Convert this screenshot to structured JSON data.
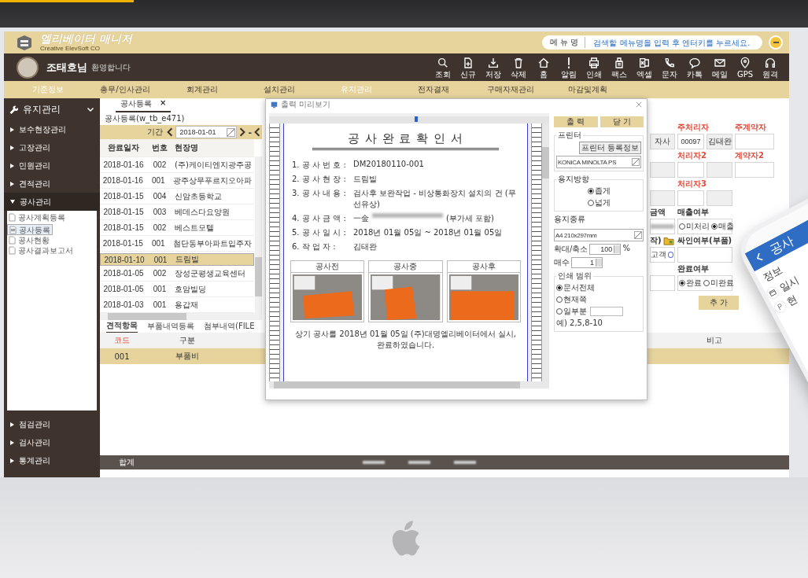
{
  "app_header": {
    "title": "엘리베이터 매니저",
    "subtitle": "Creative ElevSoft CO",
    "search": {
      "label": "메 뉴 명",
      "placeholder": "검색할 메뉴명을 입력 후 엔터키를 누르세요."
    }
  },
  "user_bar": {
    "name": "조태호님",
    "greeting": "환영합니다",
    "tools": [
      {
        "kind": "search",
        "label": "조회"
      },
      {
        "kind": "new",
        "label": "신규"
      },
      {
        "kind": "save",
        "label": "저장"
      },
      {
        "kind": "delete",
        "label": "삭제"
      },
      {
        "kind": "home",
        "label": "홈"
      },
      {
        "kind": "alert",
        "label": "알림"
      },
      {
        "kind": "print",
        "label": "인쇄"
      },
      {
        "kind": "fax",
        "label": "팩스"
      },
      {
        "kind": "excel",
        "label": "엑셀"
      },
      {
        "kind": "phone",
        "label": "문자"
      },
      {
        "kind": "talk",
        "label": "카톡"
      },
      {
        "kind": "mail",
        "label": "메일"
      },
      {
        "kind": "gps",
        "label": "GPS"
      },
      {
        "kind": "headset",
        "label": "원격"
      }
    ]
  },
  "menu": [
    {
      "label": "기준정보",
      "highlighted": true
    },
    {
      "label": "총무/인사관리",
      "highlighted": false
    },
    {
      "label": "회계관리",
      "highlighted": false
    },
    {
      "label": "설치관리",
      "highlighted": false
    },
    {
      "label": "유지관리",
      "highlighted": true
    },
    {
      "label": "전자결재",
      "highlighted": false
    },
    {
      "label": "구매자재관리",
      "highlighted": false
    },
    {
      "label": "마감및계획",
      "highlighted": false
    }
  ],
  "sidebar": {
    "title": "유지관리",
    "items": [
      {
        "label": "보수현장관리",
        "expanded": false
      },
      {
        "label": "고장관리",
        "expanded": false
      },
      {
        "label": "민원관리",
        "expanded": false
      },
      {
        "label": "견적관리",
        "expanded": false
      },
      {
        "label": "공사관리",
        "expanded": true,
        "children": [
          {
            "label": "공사계획등록",
            "selected": false
          },
          {
            "label": "공사등록",
            "selected": true
          },
          {
            "label": "공사현황",
            "selected": false
          },
          {
            "label": "공사결과보고서",
            "selected": false
          }
        ]
      },
      {
        "label": "점검관리",
        "expanded": false
      },
      {
        "label": "검사관리",
        "expanded": false
      },
      {
        "label": "통계관리",
        "expanded": false
      }
    ]
  },
  "tab": {
    "label": "공사등록",
    "close": "×"
  },
  "breadcrumb": "공사등록(w_tb_e471)",
  "filter": {
    "label": "기간",
    "date": "2018-01-01",
    "separator": "-"
  },
  "list": {
    "columns": [
      "완료일자",
      "번호",
      "현장명"
    ],
    "rows": [
      {
        "cells": [
          "2018-01-16",
          "002",
          "(주)케이티엔지광주공"
        ],
        "selected": false
      },
      {
        "cells": [
          "2018-01-16",
          "001",
          "광주상무푸르지오아파"
        ],
        "selected": false
      },
      {
        "cells": [
          "2018-01-15",
          "004",
          "신암초등학교"
        ],
        "selected": false
      },
      {
        "cells": [
          "2018-01-15",
          "003",
          "베데스다요양원"
        ],
        "selected": false
      },
      {
        "cells": [
          "2018-01-15",
          "002",
          "베스트모텔"
        ],
        "selected": false
      },
      {
        "cells": [
          "2018-01-15",
          "001",
          "첨단동부아파트입주자"
        ],
        "selected": false
      },
      {
        "cells": [
          "2018-01-10",
          "001",
          "드림빌"
        ],
        "selected": true
      },
      {
        "cells": [
          "2018-01-05",
          "002",
          "장성군평생교육센터"
        ],
        "selected": false
      },
      {
        "cells": [
          "2018-01-05",
          "001",
          "호암빌딩"
        ],
        "selected": false
      },
      {
        "cells": [
          "2018-01-03",
          "001",
          "용갑재"
        ],
        "selected": false
      }
    ]
  },
  "subtabs": [
    {
      "label": "견적항목",
      "selected": true
    },
    {
      "label": "부품내역등록",
      "selected": false
    },
    {
      "label": "첨부내역(FILE",
      "selected": false
    }
  ],
  "detail_table": {
    "columns": [
      "코드",
      "구분",
      "비고"
    ],
    "rows": [
      {
        "code": "001",
        "type": "부품비"
      }
    ]
  },
  "form": {
    "branch_value": "자사",
    "main_handler": {
      "label": "주처리자",
      "required": true,
      "code": "00097",
      "name": "김태완"
    },
    "main_contractor": {
      "label": "주계약자",
      "required": true
    },
    "handler2": {
      "label": "처리자2",
      "required": true
    },
    "contractor2": {
      "label": "계약자2",
      "required": true
    },
    "handler3": {
      "label": "처리자3",
      "required": true
    },
    "amount": {
      "label": "금액"
    },
    "sales": {
      "label": "매출여부",
      "options": [
        {
          "label": "미처리",
          "selected": false
        },
        {
          "label": "매출",
          "selected": true
        }
      ]
    },
    "partial_label": "작)",
    "sign": {
      "label": "싸인여부(부품)"
    },
    "customer": {
      "label": "고객",
      "checked": false
    },
    "completion": {
      "label": "완료여부",
      "options": [
        {
          "label": "완료",
          "selected": true
        },
        {
          "label": "미완료",
          "selected": false
        }
      ]
    },
    "add_button": "추 가"
  },
  "dialog": {
    "title": "출력 미리보기",
    "buttons": [
      "출 력",
      "닫 기"
    ],
    "printer": {
      "legend": "프린터",
      "info_button": "프린터 등록정보",
      "selected_printer": "KONICA MINOLTA PS"
    },
    "orientation": {
      "legend": "용지방향",
      "options": [
        {
          "label": "좁게",
          "selected": true
        },
        {
          "label": "넓게",
          "selected": false
        }
      ]
    },
    "paper": {
      "label": "용지종류",
      "value": "A4 210x297mm"
    },
    "zoom": {
      "label": "확대/축소",
      "value": "100",
      "unit": "%"
    },
    "copies": {
      "label": "매수",
      "value": "1"
    },
    "range": {
      "legend": "인쇄 범위",
      "options": [
        {
          "label": "문서전체",
          "selected": true
        },
        {
          "label": "현재쪽",
          "selected": false
        },
        {
          "label": "일부분",
          "selected": false
        }
      ],
      "hint": "예) 2,5,8-10"
    },
    "document": {
      "title": "공 사 완 료 확 인 서",
      "lines": [
        {
          "kind": "text",
          "label": "1. 공 사 번 호 :",
          "value": "DM20180110-001"
        },
        {
          "kind": "text",
          "label": "2. 공 사 현 장 :",
          "value": "드림빌"
        },
        {
          "kind": "text",
          "label": "3. 공 사 내 용 :",
          "value": "검사후 보완작업 - 비상통화장치 설치의 건 (무선유상)"
        },
        {
          "kind": "amount",
          "label": "4. 공 사 금 액 :",
          "value": "一金",
          "note": "(부가세 포함)"
        },
        {
          "kind": "text",
          "label": "5. 공 사 일 시 :",
          "value": "2018년 01월 05일   ~  2018년 01월 05일"
        },
        {
          "kind": "text",
          "label": "6. 작 업 자 :",
          "value": "김태완"
        }
      ],
      "photos": [
        {
          "caption": "공사전"
        },
        {
          "caption": "공사중"
        },
        {
          "caption": "공사후"
        }
      ],
      "closing": "상기 공사를 2018년 01월 05일 (주)대명엘리베이터에서 실시, 완료하였습니다."
    }
  },
  "footer": {
    "label": "합계"
  },
  "phone": {
    "title": "공사",
    "section": "정보",
    "items": [
      {
        "kind": "calendar",
        "label": "일시"
      },
      {
        "kind": "pin",
        "label": "현"
      }
    ]
  }
}
